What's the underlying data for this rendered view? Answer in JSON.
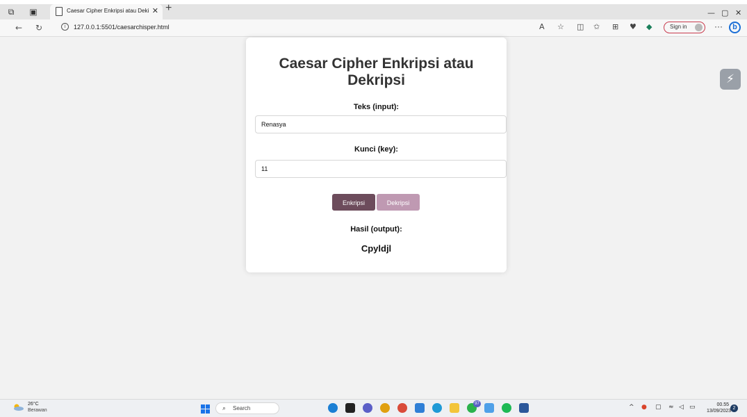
{
  "browser": {
    "tab_title": "Caesar Cipher Enkripsi atau Deki",
    "url": "127.0.0.1:5501/caesarchisper.html",
    "sign_in_label": "Sign in",
    "new_tab_glyph": "+",
    "more_glyph": "···"
  },
  "page": {
    "heading_line1": "Caesar Cipher Enkripsi atau",
    "heading_line2": "Dekripsi",
    "input_label": "Teks (input):",
    "input_value": "Renasya",
    "key_label": "Kunci (key):",
    "key_value": "11",
    "encrypt_label": "Enkripsi",
    "decrypt_label": "Dekripsi",
    "output_label": "Hasil (output):",
    "output_value": "Cpyldjl"
  },
  "colors": {
    "encrypt_button": "#6d4c5c",
    "decrypt_button": "#bf99b2",
    "page_background": "#f2f2f2"
  },
  "taskbar": {
    "temperature": "26°C",
    "weather": "Berawan",
    "search_label": "Search",
    "badge_count": "97",
    "time": "00.55",
    "date": "13/09/2023"
  }
}
